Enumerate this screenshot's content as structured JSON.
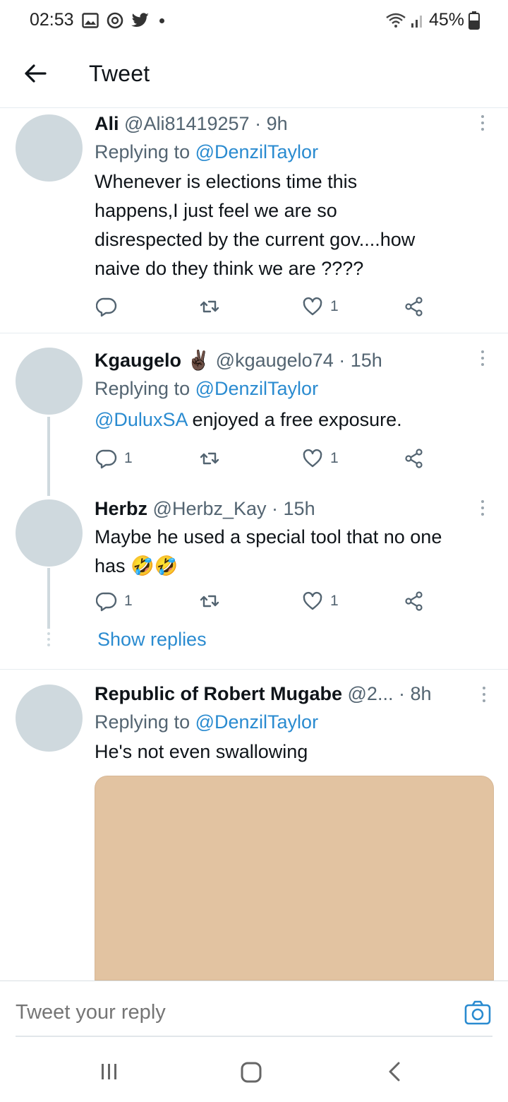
{
  "status_bar": {
    "time": "02:53",
    "battery": "45%"
  },
  "header": {
    "title": "Tweet"
  },
  "tweets": [
    {
      "name": "Ali",
      "handle": "@Ali81419257",
      "time": "9h",
      "replying_prefix": "Replying to",
      "replying_to": "@DenzilTaylor",
      "text_lines": [
        "Whenever is elections time this",
        "happens,I just feel we are so",
        "disrespected by the current gov....how",
        "naive do they think we are ????"
      ],
      "replies": "",
      "likes": "1"
    },
    {
      "name": "Kgaugelo",
      "emoji": "✌🏿",
      "handle": "@kgaugelo74",
      "time": "15h",
      "replying_prefix": "Replying to",
      "replying_to": "@DenzilTaylor",
      "mention": "@DuluxSA",
      "text": "enjoyed a free exposure.",
      "replies": "1",
      "likes": "1"
    },
    {
      "name": "Herbz",
      "handle": "@Herbz_Kay",
      "time": "15h",
      "text_line1": "Maybe he used a special tool that no one",
      "text_line2": "has",
      "emoji": "🤣🤣",
      "replies": "1",
      "likes": "1",
      "show_replies": "Show replies"
    },
    {
      "name": "Republic of Robert Mugabe",
      "handle": "@2...",
      "time": "8h",
      "replying_prefix": "Replying to",
      "replying_to": "@DenzilTaylor",
      "text": "He's not even swallowing"
    }
  ],
  "reply_bar": {
    "placeholder": "Tweet your reply"
  },
  "icons": {
    "back": "arrow-left-icon",
    "reply": "comment-icon",
    "retweet": "retweet-icon",
    "like": "heart-icon",
    "share": "share-icon",
    "more": "more-vertical-icon",
    "camera": "camera-icon"
  },
  "colors": {
    "accent": "#2a8bd0",
    "secondary_text": "#536471",
    "avatar_placeholder": "#cfd9de",
    "media_placeholder": "#e2c3a1"
  }
}
